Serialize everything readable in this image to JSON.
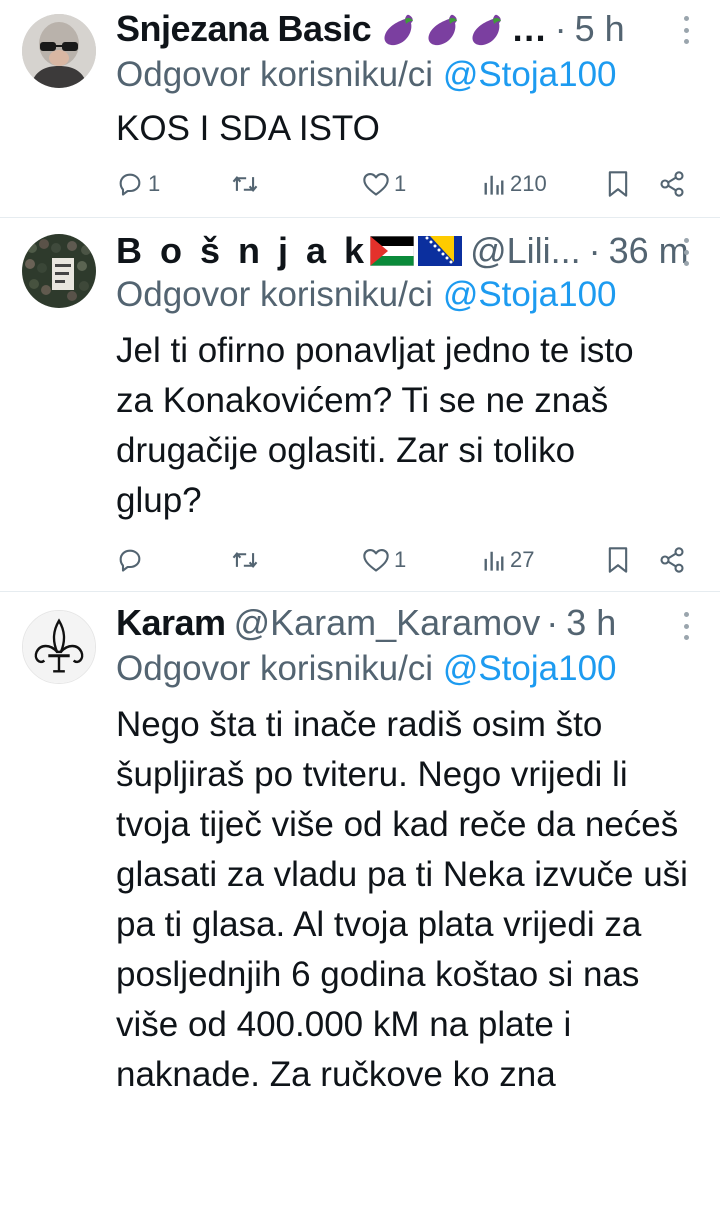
{
  "reply_prefix": "Odgovor korisniku/ci",
  "tweets": [
    {
      "name": "Snjezana Basic",
      "emoji_suffix": "…",
      "handle": "",
      "separator": "·",
      "time": "5 h",
      "reply_to": "@Stoja100",
      "text": "KOS I SDA ISTO",
      "replies": "1",
      "retweets": "",
      "likes": "1",
      "views": "210"
    },
    {
      "name": "B o š n j a k",
      "emoji_suffix": "",
      "handle": "@Lili...",
      "separator": "·",
      "time": "36 m",
      "reply_to": "@Stoja100",
      "text": "Jel ti ofirno ponavljat jedno te isto za Konakovićem? Ti se ne znaš drugačije oglasiti. Zar si toliko glup?",
      "replies": "",
      "retweets": "",
      "likes": "1",
      "views": "27"
    },
    {
      "name": "Karam",
      "emoji_suffix": "",
      "handle": "@Karam_Karamov",
      "separator": "·",
      "time": "3 h",
      "reply_to": "@Stoja100",
      "text": "Nego šta ti inače radiš osim što šupljiraš po tviteru. Nego vrijedi li tvoja tiječ više od kad reče da nećeš glasati za vladu pa ti Neka izvuče uši pa ti glasa. Al tvoja plata vrijedi za posljednjih 6 godina koštao si nas više od 400.000 kM na plate i naknade. Za ručkove ko zna"
    }
  ],
  "colors": {
    "text": "#0f1419",
    "secondary": "#536471",
    "link": "#1d9bf0",
    "divider": "#e6ecf0",
    "eggplant": "#7b3fa0"
  },
  "icons": [
    "reply-icon",
    "retweet-icon",
    "like-icon",
    "views-icon",
    "bookmark-icon",
    "share-icon",
    "more-icon",
    "eggplant-icon",
    "palestine-flag-icon",
    "bosnia-flag-icon",
    "fleur-de-lis-icon"
  ]
}
